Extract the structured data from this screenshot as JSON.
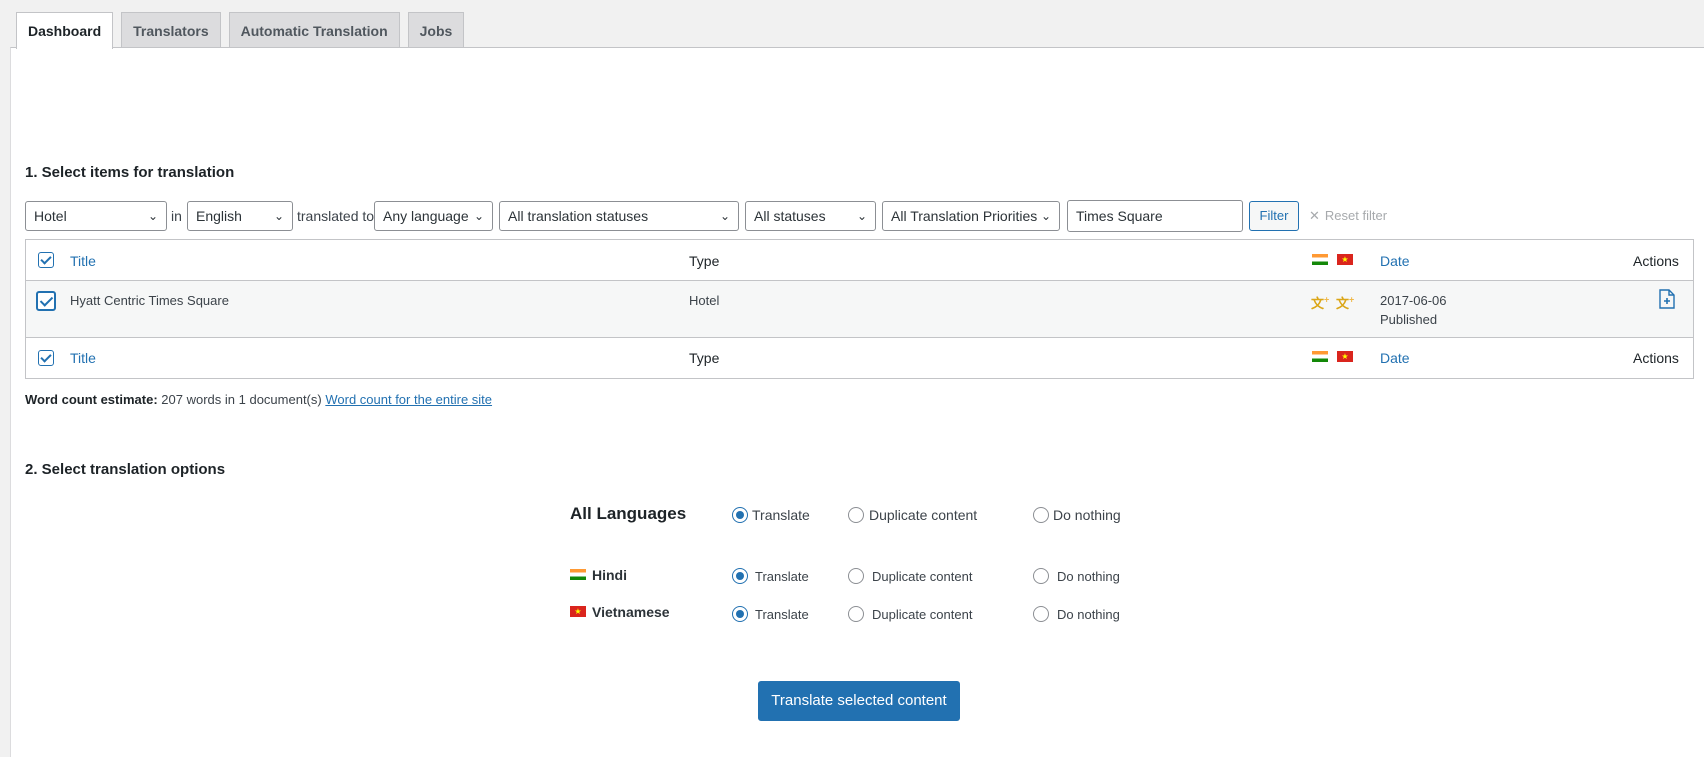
{
  "tabs": [
    "Dashboard",
    "Translators",
    "Automatic Translation",
    "Jobs"
  ],
  "section1_title": "1. Select items for translation",
  "filters": {
    "post_type": "Hotel",
    "in_label": "in",
    "source_language": "English",
    "translated_to_label": "translated to",
    "target_language": "Any language",
    "translation_status": "All translation statuses",
    "status": "All statuses",
    "priority": "All Translation Priorities",
    "search_value": "Times Square",
    "filter_button": "Filter",
    "reset_label": "Reset filter"
  },
  "table": {
    "columns": {
      "title": "Title",
      "type": "Type",
      "date": "Date",
      "actions": "Actions"
    },
    "flags": [
      "flag-india-icon",
      "flag-vietnam-icon"
    ],
    "rows": [
      {
        "title": "Hyatt Centric Times Square",
        "type": "Hotel",
        "date": "2017-06-06",
        "status": "Published",
        "checked": true
      }
    ]
  },
  "word_count": {
    "label": "Word count estimate:",
    "text": "207 words in 1 document(s)",
    "link": "Word count for the entire site"
  },
  "section2_title": "2. Select translation options",
  "options": {
    "all_languages": "All Languages",
    "choices": [
      "Translate",
      "Duplicate content",
      "Do nothing"
    ],
    "languages": [
      {
        "name": "Hindi",
        "flag": "flag-india-icon",
        "selected": "Translate"
      },
      {
        "name": "Vietnamese",
        "flag": "flag-vietnam-icon",
        "selected": "Translate"
      }
    ]
  },
  "submit_button": "Translate selected content",
  "colors": {
    "accent": "#2271b1",
    "translate_icon": "#dba617"
  }
}
